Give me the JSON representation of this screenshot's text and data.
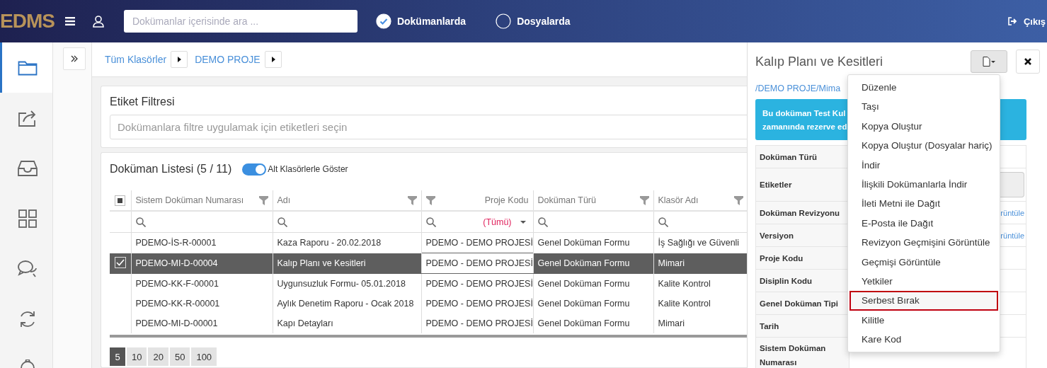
{
  "header": {
    "logo": "EDMS",
    "search": {
      "placeholder": "Dokümanlar içerisinde ara ..."
    },
    "scope_options": [
      {
        "label": "Dokümanlarda",
        "selected": true
      },
      {
        "label": "Dosyalarda",
        "selected": false
      }
    ],
    "logout": "Çıkış"
  },
  "sidebar": {
    "items": [
      {
        "kind": "folder",
        "selected": true
      },
      {
        "kind": "share",
        "selected": false
      },
      {
        "kind": "inbox",
        "selected": false
      },
      {
        "kind": "grid",
        "selected": false
      },
      {
        "kind": "chat",
        "selected": false
      },
      {
        "kind": "sync",
        "selected": false
      },
      {
        "kind": "gear",
        "selected": false
      }
    ]
  },
  "breadcrumb": [
    "Tüm Klasörler",
    "DEMO PROJE"
  ],
  "tag_filter": {
    "title": "Etiket Filtresi",
    "placeholder": "Dokümanlara filtre uygulamak için etiketleri seçin"
  },
  "document_list": {
    "title": "Doküman Listesi (5 / 11)",
    "toggle": {
      "label": "Alt Klasörlerle Göster",
      "on": true
    },
    "header_checkbox_partial": true,
    "columns": [
      {
        "label": "Sistem Doküman Numarası"
      },
      {
        "label": "Adı"
      },
      {
        "label": "Proje Kodu",
        "filter_value": "(Tümü)"
      },
      {
        "label": "Doküman Türü"
      },
      {
        "label": "Klasör Adı"
      }
    ],
    "rows": [
      {
        "selected": false,
        "cells": [
          "PDEMO-İS-R-00001",
          "Kaza Raporu - 20.02.2018",
          "PDEMO - DEMO PROJESİ",
          "Genel Doküman Formu",
          "İş Sağlığı ve Güvenli"
        ]
      },
      {
        "selected": true,
        "cells": [
          "PDEMO-MI-D-00004",
          "Kalıp Planı ve Kesitleri",
          "PDEMO - DEMO PROJESİ",
          "Genel Doküman Formu",
          "Mimari"
        ]
      },
      {
        "selected": false,
        "cells": [
          "PDEMO-KK-F-00001",
          "Uygunsuzluk Formu- 05.01.2018",
          "PDEMO - DEMO PROJESİ",
          "Genel Doküman Formu",
          "Kalite Kontrol"
        ]
      },
      {
        "selected": false,
        "cells": [
          "PDEMO-KK-R-00001",
          "Aylık Denetim Raporu - Ocak 2018",
          "PDEMO - DEMO PROJESİ",
          "Genel Doküman Formu",
          "Kalite Kontrol"
        ]
      },
      {
        "selected": false,
        "cells": [
          "PDEMO-MI-D-00001",
          "Kapı Detayları",
          "PDEMO - DEMO PROJESİ",
          "Genel Doküman Formu",
          "Mimari"
        ]
      }
    ],
    "page_sizes": [
      {
        "label": "5",
        "selected": true
      },
      {
        "label": "10",
        "selected": false
      },
      {
        "label": "20",
        "selected": false
      },
      {
        "label": "50",
        "selected": false
      },
      {
        "label": "100",
        "selected": false
      }
    ]
  },
  "detail": {
    "title": "Kalıp Planı ve Kesitleri",
    "path": "/DEMO PROJE/Mima",
    "alert_lines": [
      "Bu doküman Test Kul",
      "zamanında rezerve ed"
    ],
    "properties": [
      {
        "label": "Doküman Türü",
        "kind": "plain"
      },
      {
        "label": "Etiketler",
        "kind": "field"
      },
      {
        "label": "Doküman Revizyonu",
        "kind": "link",
        "value": "rüntüle"
      },
      {
        "label": "Versiyon",
        "kind": "link",
        "value": "rüntüle"
      },
      {
        "label": "Proje Kodu",
        "kind": "plain"
      },
      {
        "label": "Disiplin Kodu",
        "kind": "plain"
      },
      {
        "label": "Genel Doküman Tipi",
        "kind": "plain"
      },
      {
        "label": "Tarih",
        "kind": "plain"
      },
      {
        "label": "Sistem Doküman Numarası",
        "kind": "plain"
      }
    ],
    "menu": [
      {
        "label": "Düzenle",
        "highlighted": false
      },
      {
        "label": "Taşı",
        "highlighted": false
      },
      {
        "label": "Kopya Oluştur",
        "highlighted": false
      },
      {
        "label": "Kopya Oluştur (Dosyalar hariç)",
        "highlighted": false
      },
      {
        "label": "İndir",
        "highlighted": false
      },
      {
        "label": "İlişkili Dokümanlarla İndir",
        "highlighted": false
      },
      {
        "label": "İleti Metni ile Dağıt",
        "highlighted": false
      },
      {
        "label": "E-Posta ile Dağıt",
        "highlighted": false
      },
      {
        "label": "Revizyon Geçmişini Görüntüle",
        "highlighted": false
      },
      {
        "label": "Geçmişi Görüntüle",
        "highlighted": false
      },
      {
        "label": "Yetkiler",
        "highlighted": false
      },
      {
        "label": "Serbest Bırak",
        "highlighted": true
      },
      {
        "label": "Kilitle",
        "highlighted": false
      },
      {
        "label": "Kare Kod",
        "highlighted": false
      }
    ]
  }
}
